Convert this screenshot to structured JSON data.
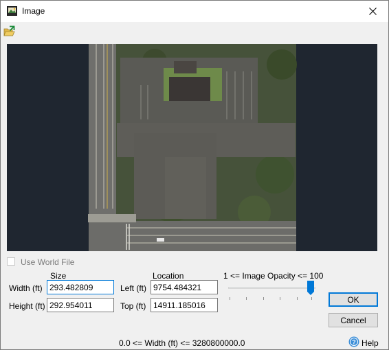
{
  "window": {
    "title": "Image"
  },
  "toolbar": {
    "open_icon": "open-folder-icon"
  },
  "options": {
    "use_world_file_label": "Use World File",
    "use_world_file_checked": false
  },
  "size": {
    "heading": "Size",
    "width_label": "Width (ft)",
    "width_value": "293.482809",
    "height_label": "Height (ft)",
    "height_value": "292.954011"
  },
  "location": {
    "heading": "Location",
    "left_label": "Left (ft)",
    "left_value": "9754.484321",
    "top_label": "Top (ft)",
    "top_value": "14911.185016"
  },
  "opacity": {
    "label": "1 <= Image Opacity <= 100",
    "value": 100,
    "min": 1,
    "max": 100
  },
  "buttons": {
    "ok": "OK",
    "cancel": "Cancel",
    "help": "Help"
  },
  "status": {
    "text": "0.0 <= Width (ft) <= 3280800000.0"
  }
}
